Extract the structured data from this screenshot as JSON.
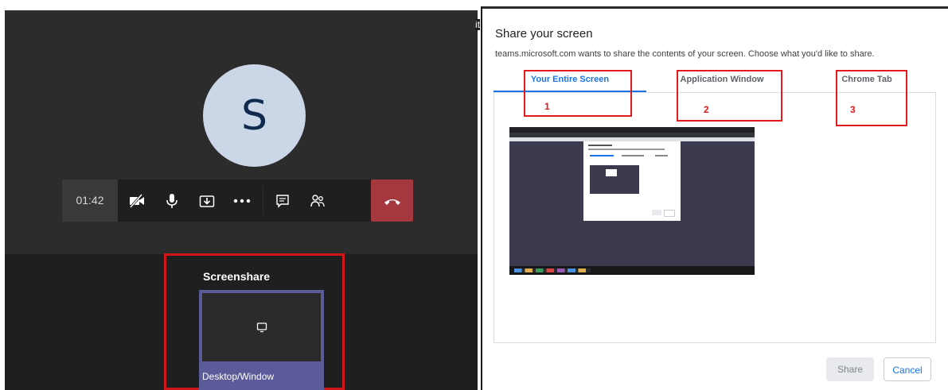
{
  "call": {
    "avatar_initial": "S",
    "timer": "01:42",
    "controls": [
      "video-off-icon",
      "mic-icon",
      "share-tray-icon",
      "more-icon",
      "chat-icon",
      "participants-icon",
      "hangup-icon"
    ],
    "screenshare": {
      "title": "Screenshare",
      "tile_label": "Desktop/Window"
    }
  },
  "dialog": {
    "title": "Share your screen",
    "subtitle": "teams.microsoft.com wants to share the contents of your screen. Choose what you'd like to share.",
    "tabs": [
      {
        "label": "Your Entire Screen",
        "active": true
      },
      {
        "label": "Application Window",
        "active": false
      },
      {
        "label": "Chrome Tab",
        "active": false
      }
    ],
    "annotations": [
      "1",
      "2",
      "3"
    ],
    "buttons": {
      "share": "Share",
      "cancel": "Cancel"
    },
    "edge_fragment": "it"
  },
  "colors": {
    "accent": "#1a73e8",
    "annotation_red": "#e21a1d",
    "hangup": "#a5373f",
    "tile": "#5b5b9a"
  }
}
